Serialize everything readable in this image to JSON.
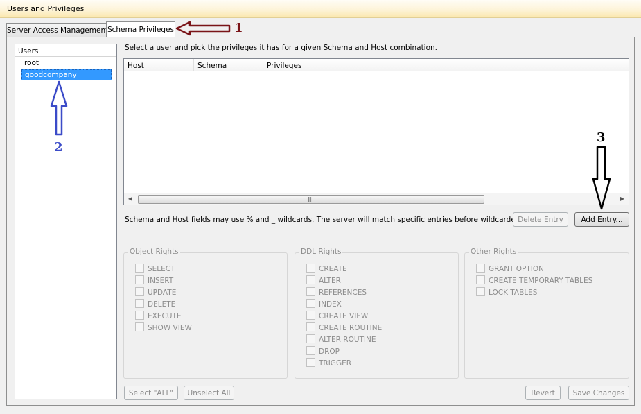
{
  "window": {
    "title": "Users and Privileges"
  },
  "tabs": [
    {
      "label": "Server Access Management"
    },
    {
      "label": "Schema Privileges"
    }
  ],
  "users": {
    "header": "Users",
    "items": [
      {
        "label": "root"
      },
      {
        "label": "goodcompany"
      }
    ],
    "selected": "goodcompany"
  },
  "instructions": "Select a user and pick the privileges it has for a given Schema and Host combination.",
  "table": {
    "columns": [
      "Host",
      "Schema",
      "Privileges"
    ],
    "rows": []
  },
  "wildcard_note": "Schema and Host fields may use % and _ wildcards. The server will match specific entries before wildcarded ones.",
  "buttons": {
    "delete_entry": "Delete Entry",
    "add_entry": "Add Entry...",
    "select_all": "Select \"ALL\"",
    "unselect_all": "Unselect All",
    "revert": "Revert",
    "save_changes": "Save Changes"
  },
  "groups": {
    "object_rights": {
      "title": "Object Rights",
      "items": [
        "SELECT",
        "INSERT",
        "UPDATE",
        "DELETE",
        "EXECUTE",
        "SHOW VIEW"
      ]
    },
    "ddl_rights": {
      "title": "DDL Rights",
      "items": [
        "CREATE",
        "ALTER",
        "REFERENCES",
        "INDEX",
        "CREATE VIEW",
        "CREATE ROUTINE",
        "ALTER ROUTINE",
        "DROP",
        "TRIGGER"
      ]
    },
    "other_rights": {
      "title": "Other Rights",
      "items": [
        "GRANT OPTION",
        "CREATE TEMPORARY TABLES",
        "LOCK TABLES"
      ]
    }
  },
  "annotations": [
    {
      "label": "1",
      "color": "#7a1418"
    },
    {
      "label": "2",
      "color": "#3b4bc8"
    },
    {
      "label": "3",
      "color": "#000000"
    }
  ],
  "colors": {
    "selection": "#3399ff",
    "titlebar": "#fbe7ad",
    "disabled_text": "#8c8c8c"
  }
}
